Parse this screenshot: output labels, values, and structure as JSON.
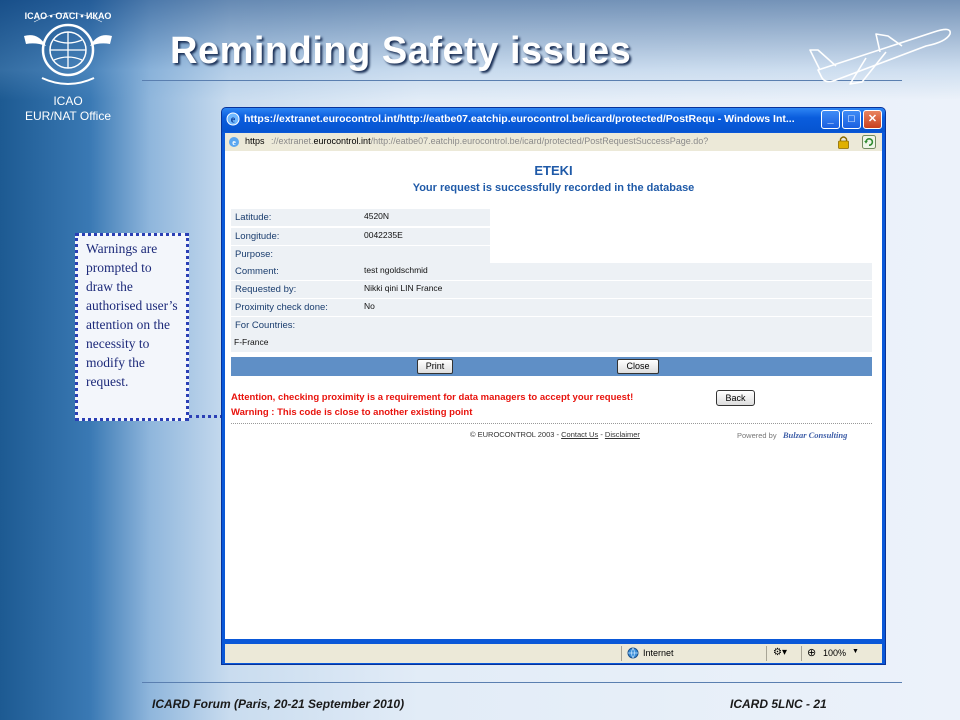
{
  "slide": {
    "title": "Reminding Safety issues",
    "org_line1": "ICAO",
    "org_line2": "EUR/NAT Office",
    "logo_text": "ICAO • OACI • ИКАО",
    "footer_left": "ICARD Forum (Paris, 20-21 September 2010)",
    "footer_right": "ICARD 5LNC - 21"
  },
  "callout": {
    "text": "Warnings are prompted to draw  the authorised user’s attention on the necessity to modify the request."
  },
  "browser": {
    "window_title": "https://extranet.eurocontrol.int/http://eatbe07.eatchip.eurocontrol.be/icard/protected/PostRequ - Windows Int...",
    "address_label": "https",
    "address_prefix": "://extranet.",
    "address_domain": "eurocontrol.int",
    "address_suffix": "/http://eatbe07.eatchip.eurocontrol.be/icard/protected/PostRequestSuccessPage.do?",
    "status_zone": "Internet",
    "zoom": "100%",
    "buttons": {
      "minimize": "_",
      "maximize": "□",
      "close": "✕"
    }
  },
  "page": {
    "heading": "ETEKI",
    "subheading": "Your request is successfully recorded in the database",
    "fields": [
      {
        "label": "Latitude:",
        "value": "4520N"
      },
      {
        "label": "Longitude:",
        "value": "0042235E"
      },
      {
        "label": "Purpose:",
        "value": ""
      },
      {
        "label": "Comment:",
        "value": "test ngoldschmid"
      },
      {
        "label": "Requested by:",
        "value": "Nikki qini LIN France"
      },
      {
        "label": "Proximity check done:",
        "value": "No"
      },
      {
        "label": "For Countries:",
        "value": "F-France"
      }
    ],
    "print_button": "Print",
    "close_button": "Close",
    "attention_text": "Attention, checking proximity is a requirement for data managers to accept your request!",
    "back_button": "Back",
    "warning_text": "Warning : This code is close to another existing point",
    "copyright": "© EUROCONTROL 2003 -",
    "contact_link": "Contact Us",
    "disclaimer_link": "Disclaimer",
    "powered_by": "Powered by",
    "powered_company": "Bulzar Consulting"
  }
}
